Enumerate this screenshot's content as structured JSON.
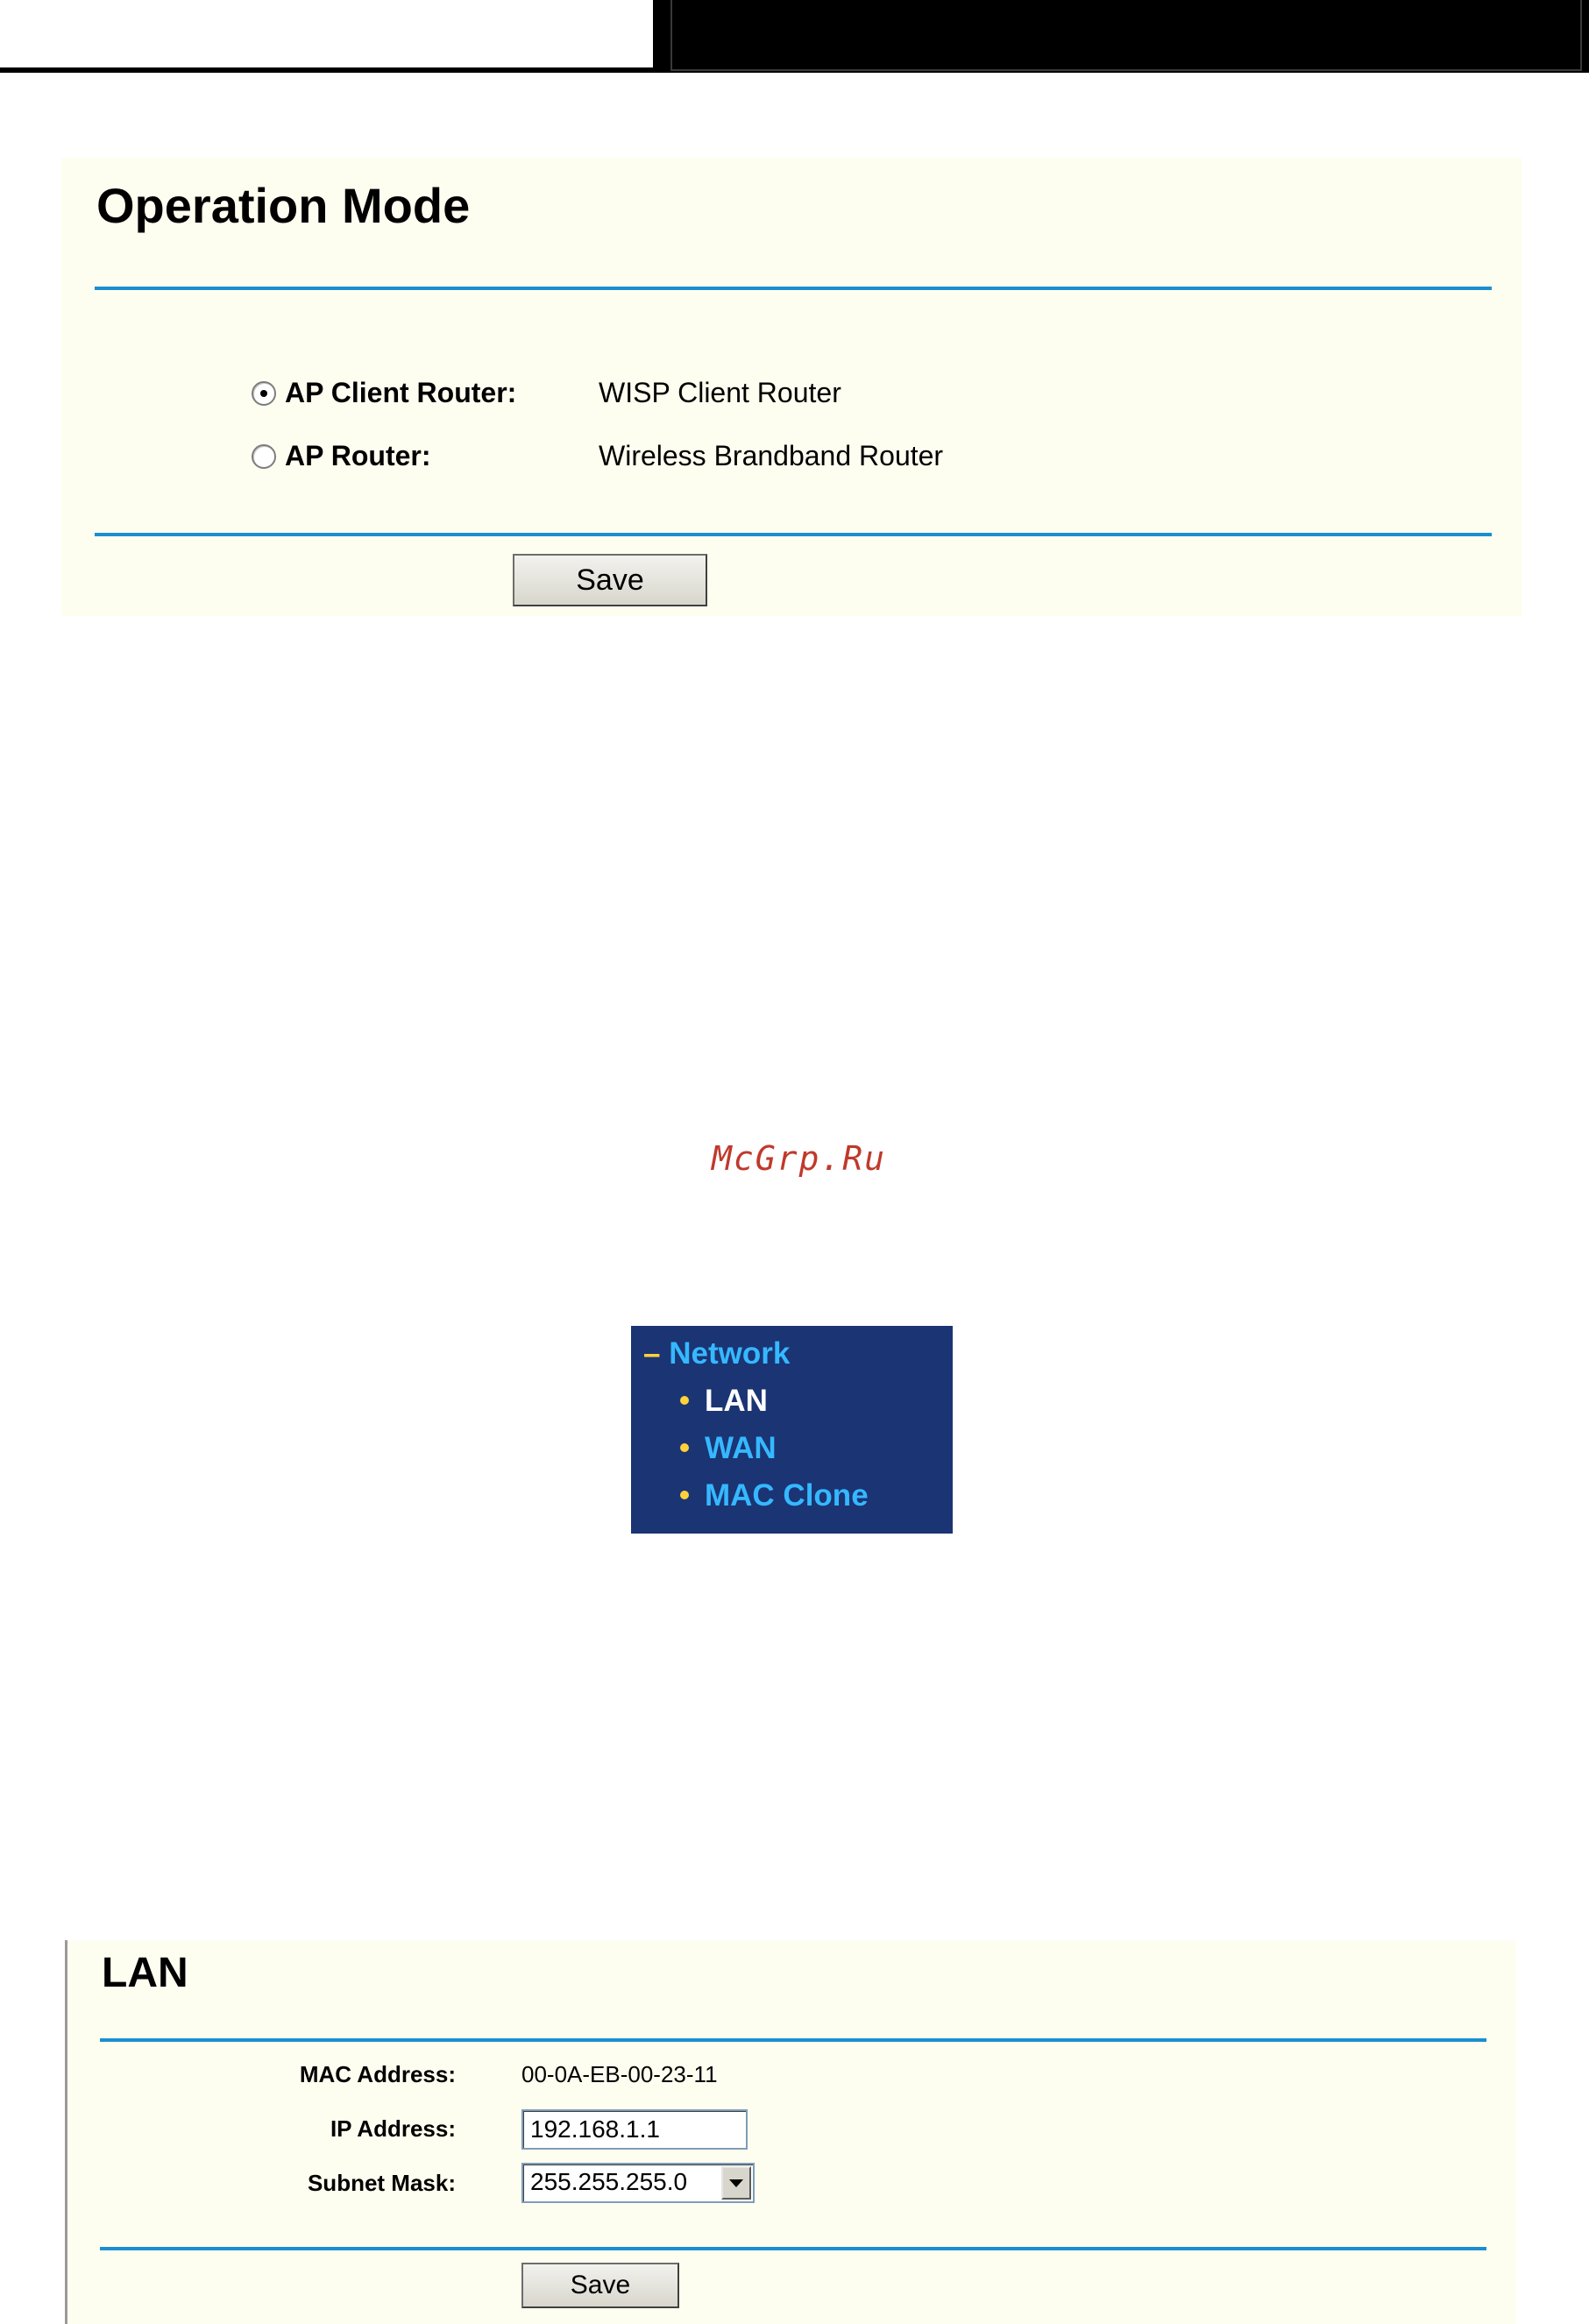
{
  "operation_mode": {
    "title": "Operation Mode",
    "options": [
      {
        "label": "AP Client Router:",
        "description": "WISP Client Router",
        "selected": true
      },
      {
        "label": "AP Router:",
        "description": "Wireless Brandband Router",
        "selected": false
      }
    ],
    "save_label": "Save"
  },
  "watermark": "McGrp.Ru",
  "network_menu": {
    "parent": "Network",
    "items": [
      "LAN",
      "WAN",
      "MAC Clone"
    ],
    "active": "LAN"
  },
  "lan": {
    "title": "LAN",
    "mac_label": "MAC Address:",
    "mac_value": "00-0A-EB-00-23-11",
    "ip_label": "IP Address:",
    "ip_value": "192.168.1.1",
    "mask_label": "Subnet Mask:",
    "mask_value": "255.255.255.0",
    "save_label": "Save"
  },
  "colors": {
    "panel_bg": "#fefef0",
    "rule_blue": "#1b8ed2",
    "menu_bg": "#1b3474",
    "menu_link": "#35b8ff",
    "menu_bullet": "#ffd23a",
    "watermark": "#c0392b"
  },
  "icons": {
    "selected_radio": "radio-checked-icon",
    "unselected_radio": "radio-unchecked-icon",
    "menu_collapse": "collapse-dash-icon",
    "menu_bullet": "bullet-icon",
    "select_arrow": "chevron-down-icon"
  }
}
